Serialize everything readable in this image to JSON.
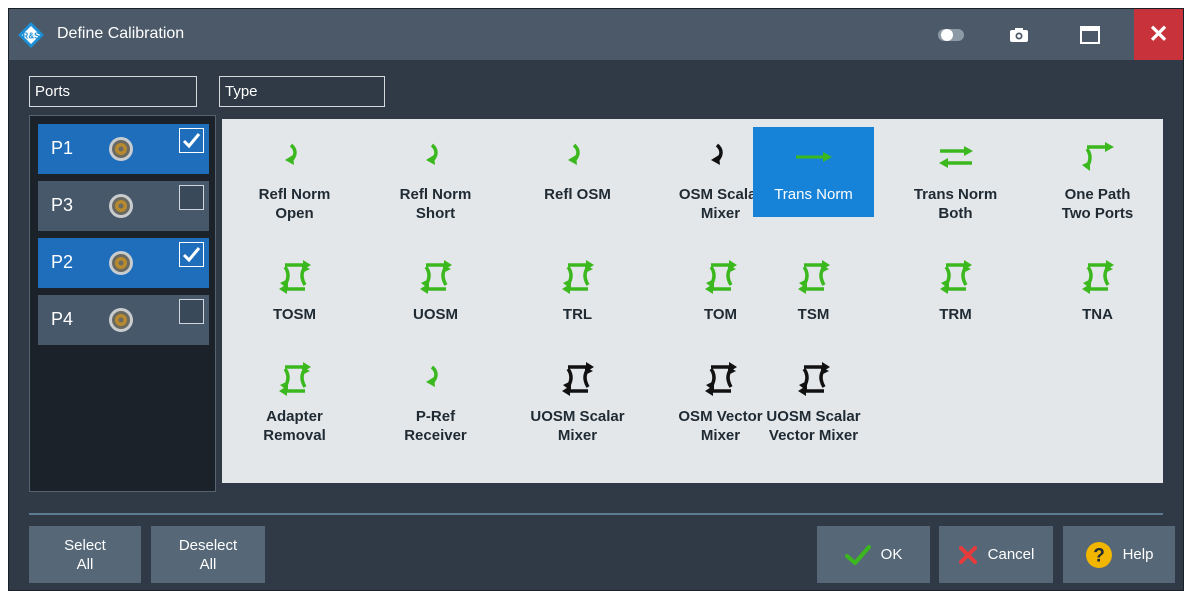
{
  "window": {
    "title": "Define Calibration"
  },
  "titlebar": {
    "icons": [
      "app-logo-icon",
      "toggle-icon",
      "camera-icon",
      "maximize-icon",
      "close-icon"
    ],
    "close_symbol": "✕"
  },
  "ports_section": {
    "label": "Ports",
    "ports": [
      {
        "label": "P1",
        "checked": true
      },
      {
        "label": "P3",
        "checked": false
      },
      {
        "label": "P2",
        "checked": true
      },
      {
        "label": "P4",
        "checked": false
      }
    ]
  },
  "type_section": {
    "label": "Type",
    "selected": "Trans Norm",
    "items": [
      {
        "label": "Refl Norm\nOpen",
        "icon": "refl-green-icon"
      },
      {
        "label": "Refl Norm\nShort",
        "icon": "refl-green-icon"
      },
      {
        "label": "Refl OSM",
        "icon": "refl-green-icon"
      },
      {
        "label": "OSM Scalar\nMixer",
        "icon": "refl-black-icon"
      },
      {
        "label": "Trans Norm",
        "icon": "arrow-right-icon"
      },
      {
        "label": "Trans Norm\nBoth",
        "icon": "double-arrow-icon"
      },
      {
        "label": "One Path\nTwo Ports",
        "icon": "one-path-icon"
      },
      {
        "label": "TOSM",
        "icon": "two-port-green-icon"
      },
      {
        "label": "UOSM",
        "icon": "two-port-green-icon"
      },
      {
        "label": "TRL",
        "icon": "two-port-green-icon"
      },
      {
        "label": "TOM",
        "icon": "two-port-green-icon"
      },
      {
        "label": "TSM",
        "icon": "two-port-green-icon"
      },
      {
        "label": "TRM",
        "icon": "two-port-green-icon"
      },
      {
        "label": "TNA",
        "icon": "two-port-green-icon"
      },
      {
        "label": "Adapter\nRemoval",
        "icon": "two-port-green-icon"
      },
      {
        "label": "P-Ref\nReceiver",
        "icon": "refl-green-icon"
      },
      {
        "label": "UOSM Scalar\nMixer",
        "icon": "two-port-black-icon"
      },
      {
        "label": "OSM Vector\nMixer",
        "icon": "two-port-black-icon"
      },
      {
        "label": "UOSM Scalar\nVector Mixer",
        "icon": "two-port-black-icon"
      }
    ]
  },
  "buttons": {
    "select_all": "Select\nAll",
    "deselect_all": "Deselect\nAll",
    "ok": "OK",
    "cancel": "Cancel",
    "help": "Help"
  },
  "colors": {
    "background": "#2f3a46",
    "titlebar": "#4b5968",
    "close": "#c8323a",
    "port_checked": "#1f6ebc",
    "selected_type": "#1682d8",
    "icon_green": "#3cb81f",
    "help_yellow": "#f2b500"
  }
}
